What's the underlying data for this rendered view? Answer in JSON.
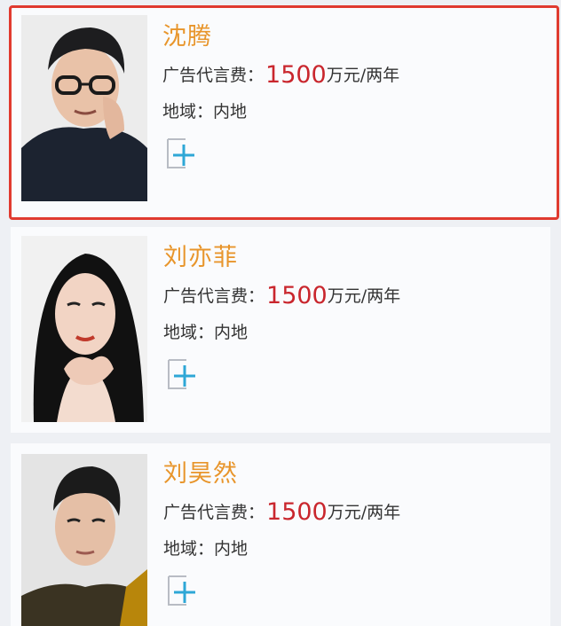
{
  "cards": [
    {
      "name": "沈腾",
      "fee_label": "广告代言费：",
      "fee_value": "1500",
      "fee_unit": "万元/两年",
      "region_label": "地域：",
      "region_value": "内地",
      "selected": true
    },
    {
      "name": "刘亦菲",
      "fee_label": "广告代言费：",
      "fee_value": "1500",
      "fee_unit": "万元/两年",
      "region_label": "地域：",
      "region_value": "内地",
      "selected": false
    },
    {
      "name": "刘昊然",
      "fee_label": "广告代言费：",
      "fee_value": "1500",
      "fee_unit": "万元/两年",
      "region_label": "地域：",
      "region_value": "内地",
      "selected": false
    }
  ],
  "colors": {
    "name": "#e8952b",
    "fee_value": "#c9262d",
    "selected_border": "#e03a2f",
    "add_icon": "#2ea7d6"
  },
  "icons": {
    "add": "add-icon"
  }
}
